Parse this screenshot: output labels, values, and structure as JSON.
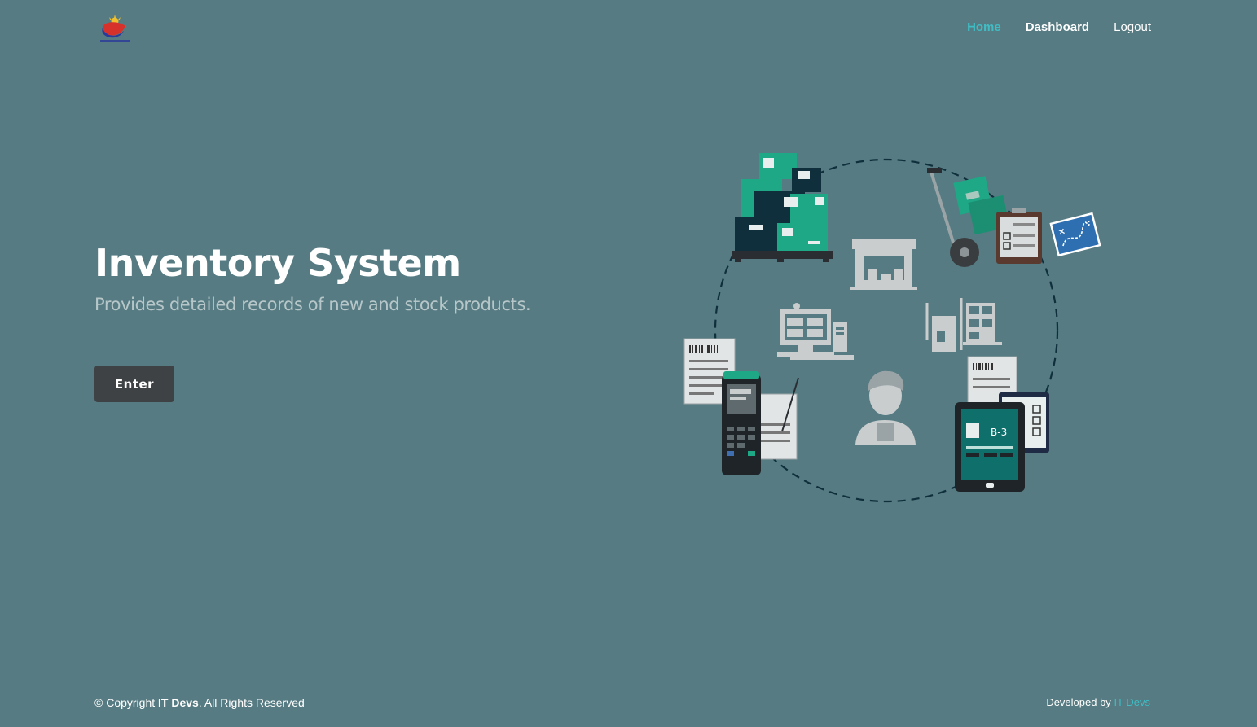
{
  "brand": {
    "logo_caption": "BAGONG PILIPINAS",
    "colors": {
      "red": "#d6322b",
      "blue": "#2b3a9a",
      "yellow": "#f2c02c"
    }
  },
  "nav": {
    "home": "Home",
    "dashboard": "Dashboard",
    "logout": "Logout",
    "active_color": "#3fbcc4"
  },
  "hero": {
    "title": "Inventory System",
    "subtitle": "Provides detailed records of new and stock products.",
    "button": "Enter"
  },
  "illustration": {
    "tablet_label": "B-3",
    "icons": [
      "boxes-pallet-icon",
      "hand-truck-icon",
      "map-icon",
      "warehouse-icon",
      "computer-icon",
      "forklift-icon",
      "scanner-icon",
      "worker-icon",
      "tablet-icon",
      "document-icon",
      "clipboard-icon"
    ]
  },
  "footer": {
    "copyright_prefix": "© Copyright ",
    "company": "IT Devs",
    "copyright_suffix": ". All Rights Reserved",
    "developed_by": "Developed by ",
    "developer": "IT Devs"
  },
  "colors": {
    "background": "#567b82",
    "button": "#3f4244",
    "accent": "#3fbcc4",
    "teal": "#1fa886",
    "navy": "#0f2f3d"
  }
}
